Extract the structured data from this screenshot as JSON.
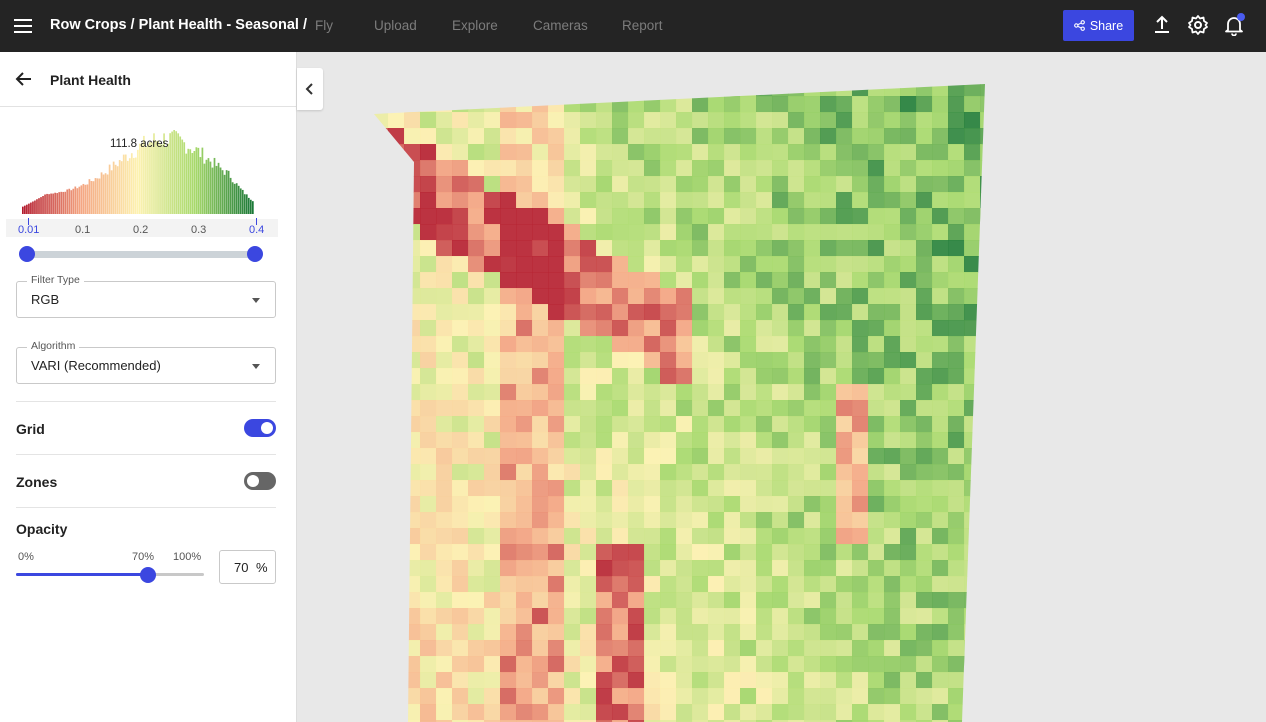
{
  "header": {
    "breadcrumb": "Row Crops / Plant Health - Seasonal /",
    "nav": [
      {
        "label": "Fly"
      },
      {
        "label": "Upload"
      },
      {
        "label": "Explore"
      },
      {
        "label": "Cameras"
      },
      {
        "label": "Report"
      }
    ],
    "share_label": "Share",
    "icons": [
      "menu-icon",
      "share-icon",
      "upload-icon",
      "gear-icon",
      "bell-icon"
    ],
    "accent_color": "#3b47e0"
  },
  "panel": {
    "title": "Plant Health",
    "histogram": {
      "label": "111.8 acres",
      "ticks": [
        "0.01",
        "0.1",
        "0.2",
        "0.3",
        "0.4"
      ],
      "range_min": 0.01,
      "range_max": 0.4,
      "colors": [
        "#b2182b",
        "#f4a582",
        "#fdf2b0",
        "#a6d96a",
        "#1a7837"
      ]
    },
    "filter_type": {
      "label": "Filter Type",
      "value": "RGB"
    },
    "algorithm": {
      "label": "Algorithm",
      "value": "VARI (Recommended)"
    },
    "grid": {
      "label": "Grid",
      "on": true
    },
    "zones": {
      "label": "Zones",
      "on": false
    },
    "opacity": {
      "label": "Opacity",
      "min_label": "0%",
      "current_label": "70%",
      "max_label": "100%",
      "value": "70",
      "unit": "%",
      "fraction": 0.7
    }
  }
}
